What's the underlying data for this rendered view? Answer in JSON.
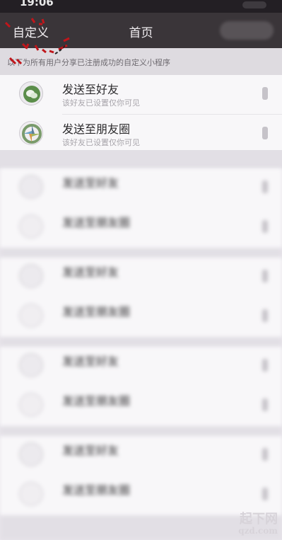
{
  "status": {
    "time": "19:06"
  },
  "topbar": {
    "left_label": "自定义",
    "title": "首页"
  },
  "banner": {
    "text": "以下为所有用户分享已注册成功的自定义小程序"
  },
  "rows": [
    {
      "title": "发送至好友",
      "subtitle": "该好友已设置仅你可见",
      "icon": "wechat-icon"
    },
    {
      "title": "发送至朋友圈",
      "subtitle": "该好友已设置仅你可见",
      "icon": "moments-icon"
    },
    {
      "title": "发送至好友",
      "subtitle": "",
      "icon": "wechat-icon"
    },
    {
      "title": "发送至朋友圈",
      "subtitle": "",
      "icon": "moments-icon"
    },
    {
      "title": "发送至好友",
      "subtitle": "",
      "icon": "wechat-icon"
    },
    {
      "title": "发送至朋友圈",
      "subtitle": "",
      "icon": "moments-icon"
    },
    {
      "title": "发送至好友",
      "subtitle": "",
      "icon": "wechat-icon"
    },
    {
      "title": "发送至朋友圈",
      "subtitle": "",
      "icon": "moments-icon"
    },
    {
      "title": "发送至好友",
      "subtitle": "",
      "icon": "wechat-icon"
    },
    {
      "title": "发送至朋友圈",
      "subtitle": "",
      "icon": "moments-icon"
    }
  ],
  "watermark": {
    "line1": "起下网",
    "line2": "qzd.com"
  },
  "colors": {
    "topbar": "#3a3539",
    "card": "#f8f7f9",
    "gap": "#e2dfe5",
    "annotation": "#c0161b"
  }
}
